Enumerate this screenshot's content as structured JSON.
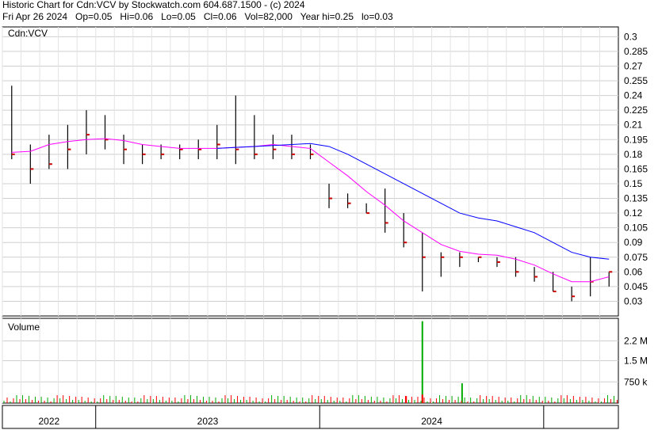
{
  "header": {
    "line1": "Historic Chart for Cdn:VCV by Stockwatch.com 604.687.1500 - (c) 2024",
    "line2": "Fri Apr 26 2024   Op=0.05   Hi=0.06   Lo=0.05   Cl=0.06   Vol=82,000   Year hi=0.25   lo=0.03"
  },
  "chart_data": [
    {
      "type": "ohlc",
      "title": "Cdn:VCV",
      "grid": true,
      "y_axis_side": "right",
      "ylim": [
        0.015,
        0.31
      ],
      "y_ticks": [
        0.03,
        0.045,
        0.06,
        0.075,
        0.09,
        0.105,
        0.12,
        0.135,
        0.15,
        0.165,
        0.18,
        0.195,
        0.21,
        0.225,
        0.24,
        0.255,
        0.27,
        0.285,
        0.3
      ],
      "x_start": "2021-08",
      "x_end": "2024-04",
      "x_sections": [
        "2022",
        "2023",
        "2024"
      ],
      "series": [
        {
          "kind": "price",
          "x": [
            "2021-08",
            "2021-09",
            "2021-10",
            "2021-11",
            "2021-12",
            "2022-01",
            "2022-02",
            "2022-03",
            "2022-04",
            "2022-05",
            "2022-06",
            "2022-07",
            "2022-08",
            "2022-09",
            "2022-10",
            "2022-11",
            "2022-12",
            "2023-01",
            "2023-02",
            "2023-03",
            "2023-04",
            "2023-05",
            "2023-06",
            "2023-07",
            "2023-08",
            "2023-09",
            "2023-10",
            "2023-11",
            "2023-12",
            "2024-01",
            "2024-02",
            "2024-03",
            "2024-04"
          ],
          "high": [
            0.25,
            0.19,
            0.2,
            0.21,
            0.225,
            0.22,
            0.2,
            0.19,
            0.19,
            0.19,
            0.195,
            0.21,
            0.24,
            0.22,
            0.2,
            0.2,
            0.19,
            0.15,
            0.14,
            0.13,
            0.145,
            0.12,
            0.1,
            0.08,
            0.08,
            0.075,
            0.075,
            0.075,
            0.065,
            0.06,
            0.045,
            0.075,
            0.06
          ],
          "low": [
            0.175,
            0.15,
            0.165,
            0.165,
            0.18,
            0.185,
            0.17,
            0.17,
            0.175,
            0.175,
            0.175,
            0.175,
            0.17,
            0.175,
            0.175,
            0.175,
            0.175,
            0.125,
            0.125,
            0.12,
            0.1,
            0.085,
            0.04,
            0.055,
            0.065,
            0.07,
            0.065,
            0.055,
            0.05,
            0.04,
            0.03,
            0.035,
            0.045
          ],
          "close": [
            0.18,
            0.165,
            0.17,
            0.185,
            0.2,
            0.195,
            0.185,
            0.18,
            0.18,
            0.185,
            0.185,
            0.19,
            0.185,
            0.18,
            0.185,
            0.18,
            0.18,
            0.135,
            0.13,
            0.12,
            0.11,
            0.09,
            0.075,
            0.075,
            0.075,
            0.075,
            0.07,
            0.06,
            0.055,
            0.04,
            0.035,
            0.05,
            0.06
          ]
        },
        {
          "kind": "moving_average",
          "color": "#ff00ff",
          "values": [
            0.182,
            0.183,
            0.19,
            0.193,
            0.195,
            0.196,
            0.194,
            0.19,
            0.188,
            0.186,
            0.186,
            0.186,
            0.187,
            0.188,
            0.19,
            0.188,
            0.186,
            0.172,
            0.158,
            0.142,
            0.128,
            0.112,
            0.1,
            0.088,
            0.081,
            0.078,
            0.077,
            0.073,
            0.067,
            0.058,
            0.05,
            0.05,
            0.055
          ]
        },
        {
          "kind": "moving_average",
          "color": "#0000ff",
          "values": [
            null,
            null,
            null,
            null,
            null,
            null,
            null,
            null,
            null,
            null,
            null,
            0.186,
            0.187,
            0.188,
            0.189,
            0.19,
            0.191,
            0.188,
            0.18,
            0.17,
            0.16,
            0.15,
            0.14,
            0.13,
            0.12,
            0.115,
            0.112,
            0.106,
            0.1,
            0.09,
            0.08,
            0.075,
            0.073
          ]
        }
      ]
    },
    {
      "type": "bar",
      "title": "Volume",
      "y_axis_side": "right",
      "ylim": [
        0,
        3000000
      ],
      "y_ticks": [
        {
          "value": 750000,
          "label": "750 k"
        },
        {
          "value": 1500000,
          "label": "1.5 M"
        },
        {
          "value": 2200000,
          "label": "2.2 M"
        }
      ],
      "spikes": [
        {
          "x": "2023-06",
          "value": 2900000,
          "color": "#00aa00"
        },
        {
          "x": "2023-08",
          "value": 700000,
          "color": "#00aa00"
        },
        {
          "x": "2023-06",
          "value": 300000,
          "color": "#ff0000"
        },
        {
          "x": "2023-05",
          "value": 250000,
          "color": "#ff0000"
        }
      ]
    }
  ]
}
